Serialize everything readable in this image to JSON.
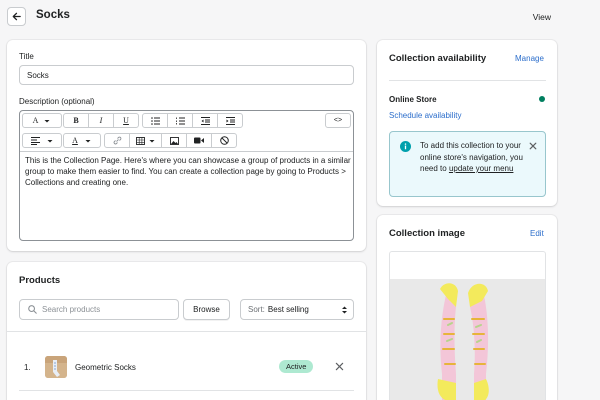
{
  "header": {
    "title": "Socks",
    "view_label": "View"
  },
  "details": {
    "title_label": "Title",
    "title_value": "Socks",
    "description_label": "Description (optional)",
    "description_text": "This is the Collection Page. Here's where you can showcase a group of products in a similar group to make them easier to find. You can create a collection page by going to Products > Collections and creating one.",
    "toolbar_icons": [
      "font-icon",
      "bold-icon",
      "italic-icon",
      "underline-icon",
      "bulleted-list-icon",
      "numbered-list-icon",
      "outdent-icon",
      "indent-icon",
      "code-view-icon",
      "align-icon",
      "text-color-icon",
      "link-icon",
      "table-icon",
      "image-icon",
      "video-icon",
      "clear-format-icon"
    ]
  },
  "products": {
    "heading": "Products",
    "search_placeholder": "Search products",
    "browse_label": "Browse",
    "sort_label": "Sort:",
    "sort_value": "Best selling",
    "items": [
      {
        "index": "1.",
        "name": "Geometric Socks",
        "status": "Active"
      }
    ]
  },
  "availability": {
    "heading": "Collection availability",
    "manage_label": "Manage",
    "channel": "Online Store",
    "channel_status_color": "#007f5f",
    "schedule_label": "Schedule availability",
    "banner_text": "To add this collection to your online store's navigation, you need to",
    "banner_link": "update your menu"
  },
  "collection_image": {
    "heading": "Collection image",
    "edit_label": "Edit"
  },
  "colors": {
    "accent": "#2c6ecb",
    "badge": "#aee9d1",
    "banner_bg": "#ebf9fc",
    "info_icon": "#00a0ac"
  }
}
